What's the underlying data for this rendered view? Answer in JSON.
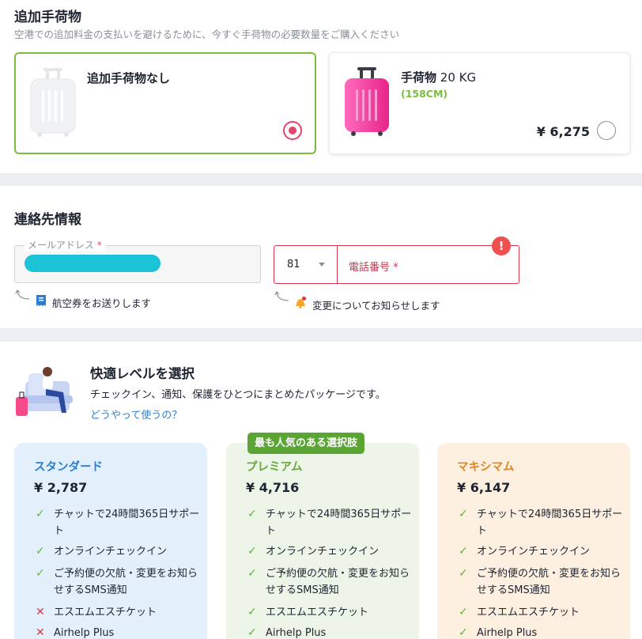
{
  "baggage": {
    "title": "追加手荷物",
    "subtitle": "空港での追加料金の支払いを避けるために、今すぐ手荷物の必要数量をご購入ください",
    "options": [
      {
        "label": "追加手荷物なし",
        "selected": true
      },
      {
        "label": "手荷物",
        "weight": " 20 KG",
        "size": "(158CM)",
        "price": "¥ 6,275",
        "selected": false
      }
    ]
  },
  "contact": {
    "title": "連絡先情報",
    "email": {
      "label": "メールアドレス",
      "required_mark": "*",
      "value": ""
    },
    "phone": {
      "country_code": "81",
      "placeholder": "電話番号",
      "required_mark": "*",
      "error_icon": "!"
    },
    "email_hint": "航空券をお送りします",
    "phone_hint": "変更についてお知らせします"
  },
  "comfort": {
    "title": "快適レベルを選択",
    "description": "チェックイン、通知、保護をひとつにまとめたパッケージです。",
    "link": "どうやって使うの？",
    "popular_badge": "最も人気のある選択肢",
    "plans": [
      {
        "name": "スタンダード",
        "price": "¥ 2,787",
        "accent": "#2a7fd4",
        "features": [
          {
            "text": "チャットで24時間365日サポート",
            "included": true
          },
          {
            "text": "オンラインチェックイン",
            "included": true
          },
          {
            "text": "ご予約便の欠航・変更をお知らせするSMS通知",
            "included": true
          },
          {
            "text": "エスエムエスチケット",
            "included": false
          },
          {
            "text": "Airhelp Plus",
            "included": false
          }
        ]
      },
      {
        "name": "プレミアム",
        "price": "¥ 4,716",
        "accent": "#6ba83a",
        "features": [
          {
            "text": "チャットで24時間365日サポート",
            "included": true
          },
          {
            "text": "オンラインチェックイン",
            "included": true
          },
          {
            "text": "ご予約便の欠航・変更をお知らせするSMS通知",
            "included": true
          },
          {
            "text": "エスエムエスチケット",
            "included": true
          },
          {
            "text": "Airhelp Plus",
            "included": true
          }
        ]
      },
      {
        "name": "マキシマム",
        "price": "¥ 6,147",
        "accent": "#e1851f",
        "features": [
          {
            "text": "チャットで24時間365日サポート",
            "included": true
          },
          {
            "text": "オンラインチェックイン",
            "included": true
          },
          {
            "text": "ご予約便の欠航・変更をお知らせするSMS通知",
            "included": true
          },
          {
            "text": "エスエムエスチケット",
            "included": true
          },
          {
            "text": "Airhelp Plus",
            "included": true
          }
        ]
      }
    ],
    "check_icon": "✓",
    "cross_icon": "✕"
  },
  "colors": {
    "selected_border": "#7bbd3f",
    "radio_active": "#e7436b",
    "error": "#d9374c",
    "link": "#2f80d0"
  }
}
